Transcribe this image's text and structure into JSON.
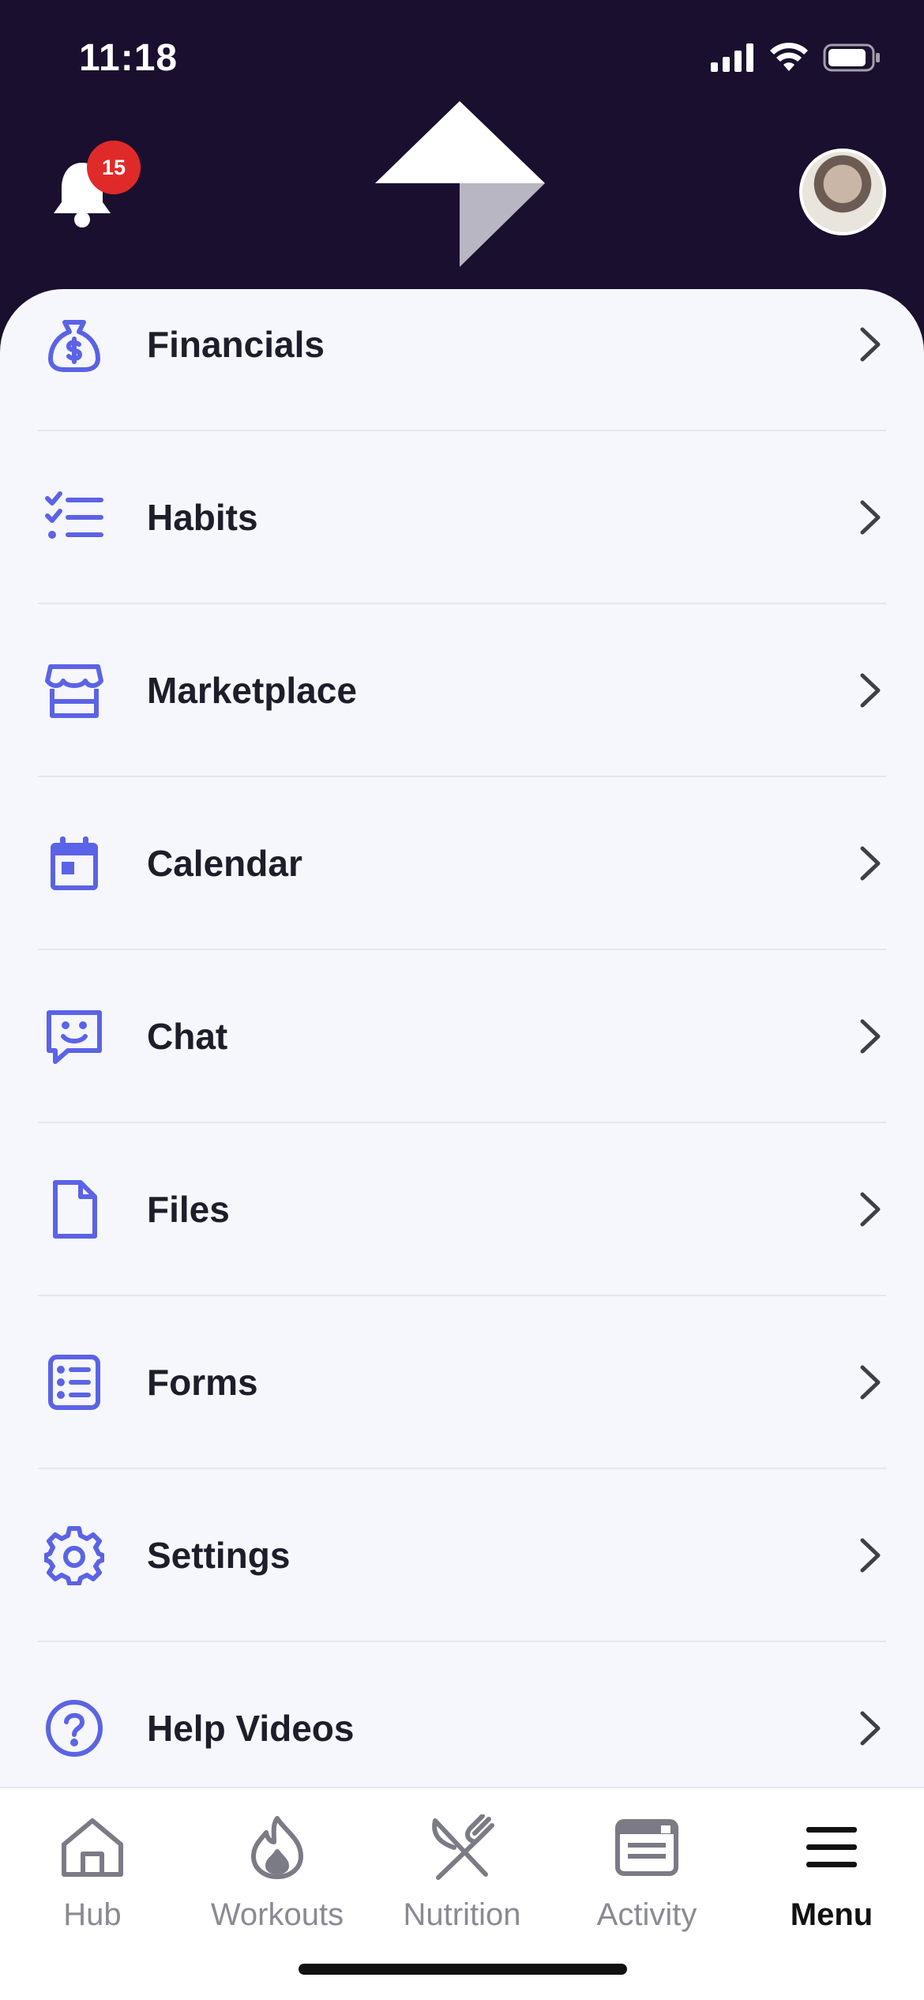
{
  "status_bar": {
    "time": "11:18"
  },
  "header": {
    "notification_count": "15"
  },
  "menu": {
    "items": [
      {
        "label": "Financials",
        "icon": "money-bag-icon"
      },
      {
        "label": "Habits",
        "icon": "checklist-icon"
      },
      {
        "label": "Marketplace",
        "icon": "storefront-icon"
      },
      {
        "label": "Calendar",
        "icon": "calendar-icon"
      },
      {
        "label": "Chat",
        "icon": "chat-smile-icon"
      },
      {
        "label": "Files",
        "icon": "file-icon"
      },
      {
        "label": "Forms",
        "icon": "form-list-icon"
      },
      {
        "label": "Settings",
        "icon": "gear-icon"
      },
      {
        "label": "Help Videos",
        "icon": "help-circle-icon"
      }
    ]
  },
  "tabbar": {
    "tabs": [
      {
        "label": "Hub",
        "icon": "home-icon"
      },
      {
        "label": "Workouts",
        "icon": "flame-icon"
      },
      {
        "label": "Nutrition",
        "icon": "fork-knife-icon"
      },
      {
        "label": "Activity",
        "icon": "activity-card-icon"
      },
      {
        "label": "Menu",
        "icon": "hamburger-icon"
      }
    ],
    "active": "Menu"
  },
  "colors": {
    "header_bg": "#1a0f2e",
    "accent": "#5b63e6",
    "badge": "#e02a2a",
    "card_bg": "#f6f7fc"
  }
}
